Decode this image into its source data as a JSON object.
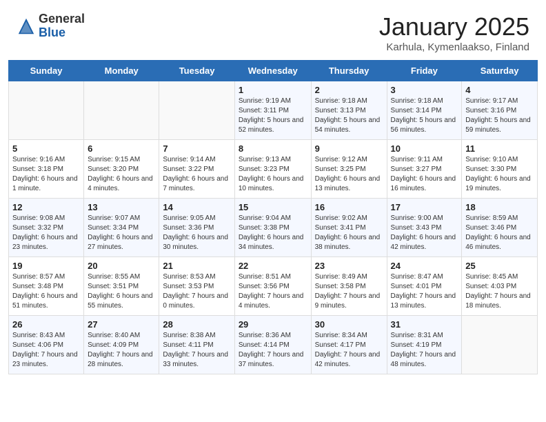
{
  "header": {
    "logo_general": "General",
    "logo_blue": "Blue",
    "month_title": "January 2025",
    "subtitle": "Karhula, Kymenlaakso, Finland"
  },
  "weekdays": [
    "Sunday",
    "Monday",
    "Tuesday",
    "Wednesday",
    "Thursday",
    "Friday",
    "Saturday"
  ],
  "weeks": [
    [
      {
        "day": "",
        "info": ""
      },
      {
        "day": "",
        "info": ""
      },
      {
        "day": "",
        "info": ""
      },
      {
        "day": "1",
        "info": "Sunrise: 9:19 AM\nSunset: 3:11 PM\nDaylight: 5 hours and 52 minutes."
      },
      {
        "day": "2",
        "info": "Sunrise: 9:18 AM\nSunset: 3:13 PM\nDaylight: 5 hours and 54 minutes."
      },
      {
        "day": "3",
        "info": "Sunrise: 9:18 AM\nSunset: 3:14 PM\nDaylight: 5 hours and 56 minutes."
      },
      {
        "day": "4",
        "info": "Sunrise: 9:17 AM\nSunset: 3:16 PM\nDaylight: 5 hours and 59 minutes."
      }
    ],
    [
      {
        "day": "5",
        "info": "Sunrise: 9:16 AM\nSunset: 3:18 PM\nDaylight: 6 hours and 1 minute."
      },
      {
        "day": "6",
        "info": "Sunrise: 9:15 AM\nSunset: 3:20 PM\nDaylight: 6 hours and 4 minutes."
      },
      {
        "day": "7",
        "info": "Sunrise: 9:14 AM\nSunset: 3:22 PM\nDaylight: 6 hours and 7 minutes."
      },
      {
        "day": "8",
        "info": "Sunrise: 9:13 AM\nSunset: 3:23 PM\nDaylight: 6 hours and 10 minutes."
      },
      {
        "day": "9",
        "info": "Sunrise: 9:12 AM\nSunset: 3:25 PM\nDaylight: 6 hours and 13 minutes."
      },
      {
        "day": "10",
        "info": "Sunrise: 9:11 AM\nSunset: 3:27 PM\nDaylight: 6 hours and 16 minutes."
      },
      {
        "day": "11",
        "info": "Sunrise: 9:10 AM\nSunset: 3:30 PM\nDaylight: 6 hours and 19 minutes."
      }
    ],
    [
      {
        "day": "12",
        "info": "Sunrise: 9:08 AM\nSunset: 3:32 PM\nDaylight: 6 hours and 23 minutes."
      },
      {
        "day": "13",
        "info": "Sunrise: 9:07 AM\nSunset: 3:34 PM\nDaylight: 6 hours and 27 minutes."
      },
      {
        "day": "14",
        "info": "Sunrise: 9:05 AM\nSunset: 3:36 PM\nDaylight: 6 hours and 30 minutes."
      },
      {
        "day": "15",
        "info": "Sunrise: 9:04 AM\nSunset: 3:38 PM\nDaylight: 6 hours and 34 minutes."
      },
      {
        "day": "16",
        "info": "Sunrise: 9:02 AM\nSunset: 3:41 PM\nDaylight: 6 hours and 38 minutes."
      },
      {
        "day": "17",
        "info": "Sunrise: 9:00 AM\nSunset: 3:43 PM\nDaylight: 6 hours and 42 minutes."
      },
      {
        "day": "18",
        "info": "Sunrise: 8:59 AM\nSunset: 3:46 PM\nDaylight: 6 hours and 46 minutes."
      }
    ],
    [
      {
        "day": "19",
        "info": "Sunrise: 8:57 AM\nSunset: 3:48 PM\nDaylight: 6 hours and 51 minutes."
      },
      {
        "day": "20",
        "info": "Sunrise: 8:55 AM\nSunset: 3:51 PM\nDaylight: 6 hours and 55 minutes."
      },
      {
        "day": "21",
        "info": "Sunrise: 8:53 AM\nSunset: 3:53 PM\nDaylight: 7 hours and 0 minutes."
      },
      {
        "day": "22",
        "info": "Sunrise: 8:51 AM\nSunset: 3:56 PM\nDaylight: 7 hours and 4 minutes."
      },
      {
        "day": "23",
        "info": "Sunrise: 8:49 AM\nSunset: 3:58 PM\nDaylight: 7 hours and 9 minutes."
      },
      {
        "day": "24",
        "info": "Sunrise: 8:47 AM\nSunset: 4:01 PM\nDaylight: 7 hours and 13 minutes."
      },
      {
        "day": "25",
        "info": "Sunrise: 8:45 AM\nSunset: 4:03 PM\nDaylight: 7 hours and 18 minutes."
      }
    ],
    [
      {
        "day": "26",
        "info": "Sunrise: 8:43 AM\nSunset: 4:06 PM\nDaylight: 7 hours and 23 minutes."
      },
      {
        "day": "27",
        "info": "Sunrise: 8:40 AM\nSunset: 4:09 PM\nDaylight: 7 hours and 28 minutes."
      },
      {
        "day": "28",
        "info": "Sunrise: 8:38 AM\nSunset: 4:11 PM\nDaylight: 7 hours and 33 minutes."
      },
      {
        "day": "29",
        "info": "Sunrise: 8:36 AM\nSunset: 4:14 PM\nDaylight: 7 hours and 37 minutes."
      },
      {
        "day": "30",
        "info": "Sunrise: 8:34 AM\nSunset: 4:17 PM\nDaylight: 7 hours and 42 minutes."
      },
      {
        "day": "31",
        "info": "Sunrise: 8:31 AM\nSunset: 4:19 PM\nDaylight: 7 hours and 48 minutes."
      },
      {
        "day": "",
        "info": ""
      }
    ]
  ]
}
